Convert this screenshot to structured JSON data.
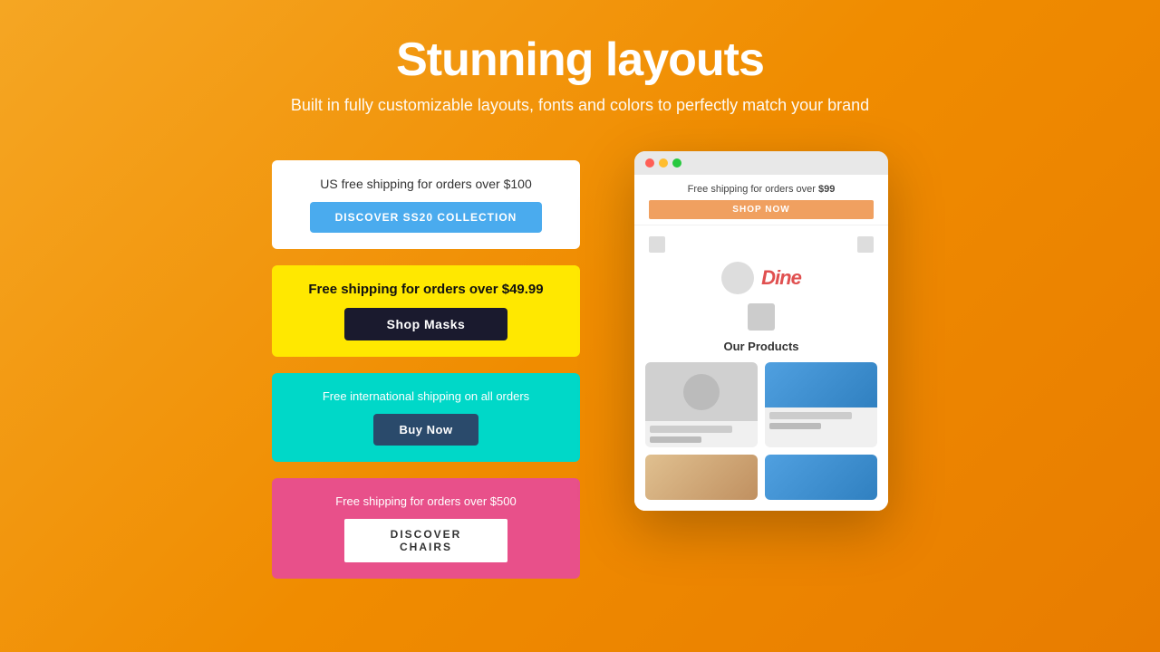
{
  "header": {
    "title": "Stunning layouts",
    "subtitle": "Built in fully customizable layouts, fonts and colors to perfectly match your brand"
  },
  "banners": [
    {
      "id": "banner-white",
      "theme": "white",
      "text": "US free shipping for orders over $100",
      "button_label": "Discover SS20 Collection",
      "button_style": "blue"
    },
    {
      "id": "banner-yellow",
      "theme": "yellow",
      "text": "Free shipping for orders over $49.99",
      "button_label": "Shop Masks",
      "button_style": "dark"
    },
    {
      "id": "banner-cyan",
      "theme": "cyan",
      "text": "Free international shipping on all orders",
      "button_label": "Buy Now",
      "button_style": "navy"
    },
    {
      "id": "banner-pink",
      "theme": "pink",
      "text": "Free shipping for orders over $500",
      "button_label": "DISCOVER CHAIRS",
      "button_style": "white"
    }
  ],
  "phone_mockup": {
    "notif_bar": {
      "text": "Free shipping for orders over ",
      "highlight": "$99",
      "button_label": "SHOP NOW"
    },
    "app": {
      "brand_name": "Dine",
      "section_title": "Our Products"
    }
  },
  "colors": {
    "bg_gradient_start": "#f5a623",
    "bg_gradient_end": "#e87c00",
    "banner_white": "#ffffff",
    "banner_yellow": "#FFE800",
    "banner_cyan": "#00D8C8",
    "banner_pink": "#E8508A",
    "btn_blue": "#4AABEE",
    "btn_dark": "#1a1a2e",
    "btn_navy": "#2a4a6b",
    "btn_white": "#ffffff"
  }
}
